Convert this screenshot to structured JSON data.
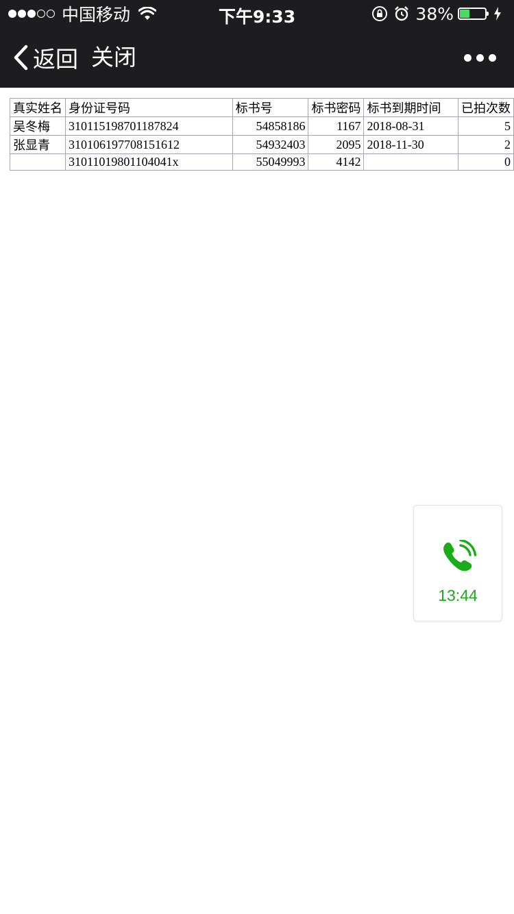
{
  "status_bar": {
    "carrier": "中国移动",
    "time": "下午9:33",
    "battery_text": "38%",
    "battery_level": 0.38,
    "signal_bars_filled": 3,
    "signal_bars_total": 5
  },
  "nav": {
    "back_label": "返回",
    "close_label": "关闭"
  },
  "table": {
    "headers": [
      "真实姓名",
      "身份证号码",
      "标书号",
      "标书密码",
      "标书到期时间",
      "已拍次数"
    ],
    "rows": [
      [
        "吴冬梅",
        "310115198701187824",
        "54858186",
        "1167",
        "2018-08-31",
        "5"
      ],
      [
        "张显青",
        "310106197708151612",
        "54932403",
        "2095",
        "2018-11-30",
        "2"
      ],
      [
        "",
        "31011019801104041x",
        "55049993",
        "4142",
        "",
        "0"
      ]
    ]
  },
  "call_widget": {
    "duration": "13:44",
    "icon": "phone-call-icon",
    "color": "#1aad19"
  },
  "colors": {
    "bar_background": "#1d1d21",
    "table_border": "#a6a3b4",
    "battery_fill": "#4cd964"
  }
}
